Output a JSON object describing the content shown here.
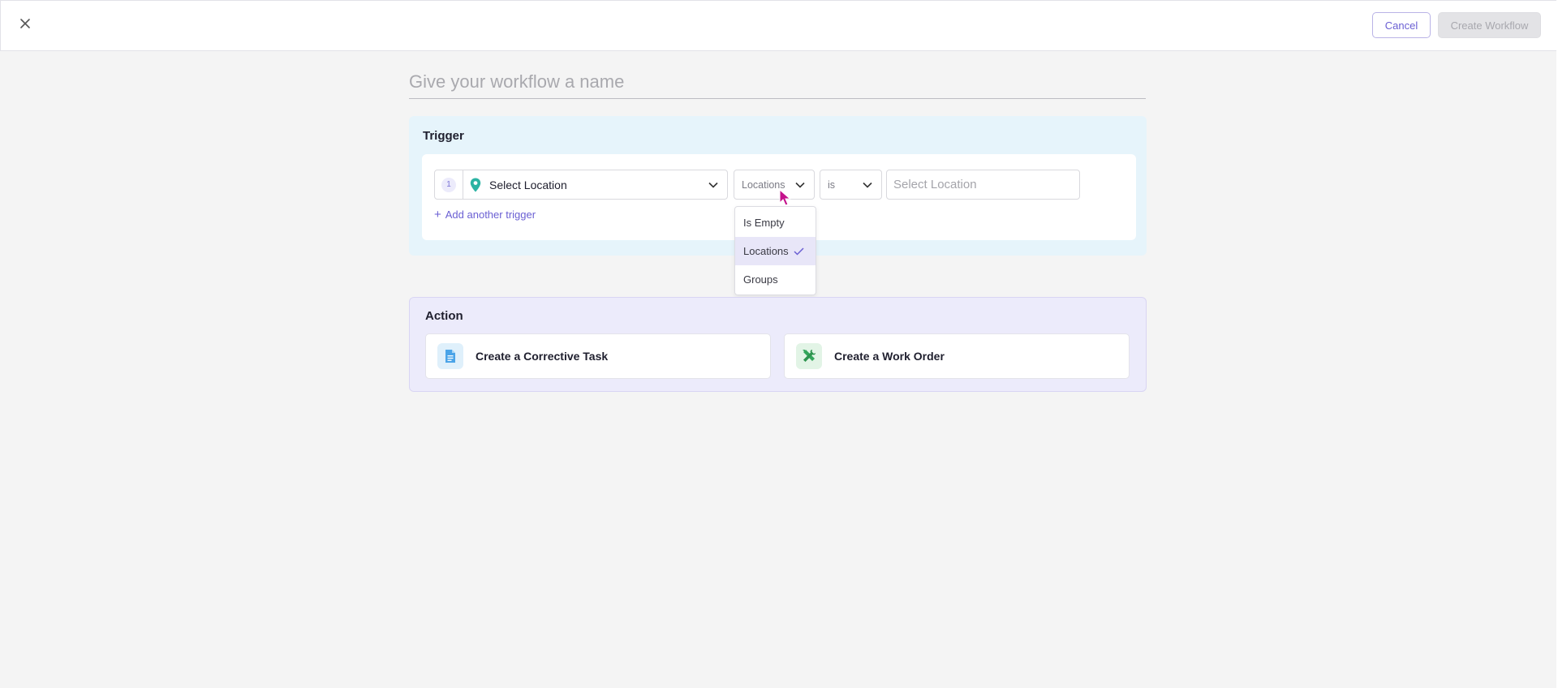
{
  "topbar": {
    "cancel_label": "Cancel",
    "create_label": "Create Workflow"
  },
  "workflow": {
    "name_placeholder": "Give your workflow a name",
    "name_value": ""
  },
  "trigger": {
    "title": "Trigger",
    "step_number": "1",
    "field_label": "Select Location",
    "type_value": "Locations",
    "operator_value": "is",
    "value_placeholder": "Select Location",
    "add_label": "Add another trigger",
    "dropdown_options": [
      {
        "label": "Is Empty",
        "selected": false
      },
      {
        "label": "Locations",
        "selected": true
      },
      {
        "label": "Groups",
        "selected": false
      }
    ]
  },
  "action": {
    "title": "Action",
    "cards": [
      {
        "label": "Create a Corrective Task",
        "icon": "document-icon"
      },
      {
        "label": "Create a Work Order",
        "icon": "tools-icon"
      }
    ]
  },
  "colors": {
    "accent": "#6a5fd3",
    "trigger_bg": "#e6f4fb",
    "action_bg": "#ecebfb",
    "pin": "#2bb3a3"
  }
}
